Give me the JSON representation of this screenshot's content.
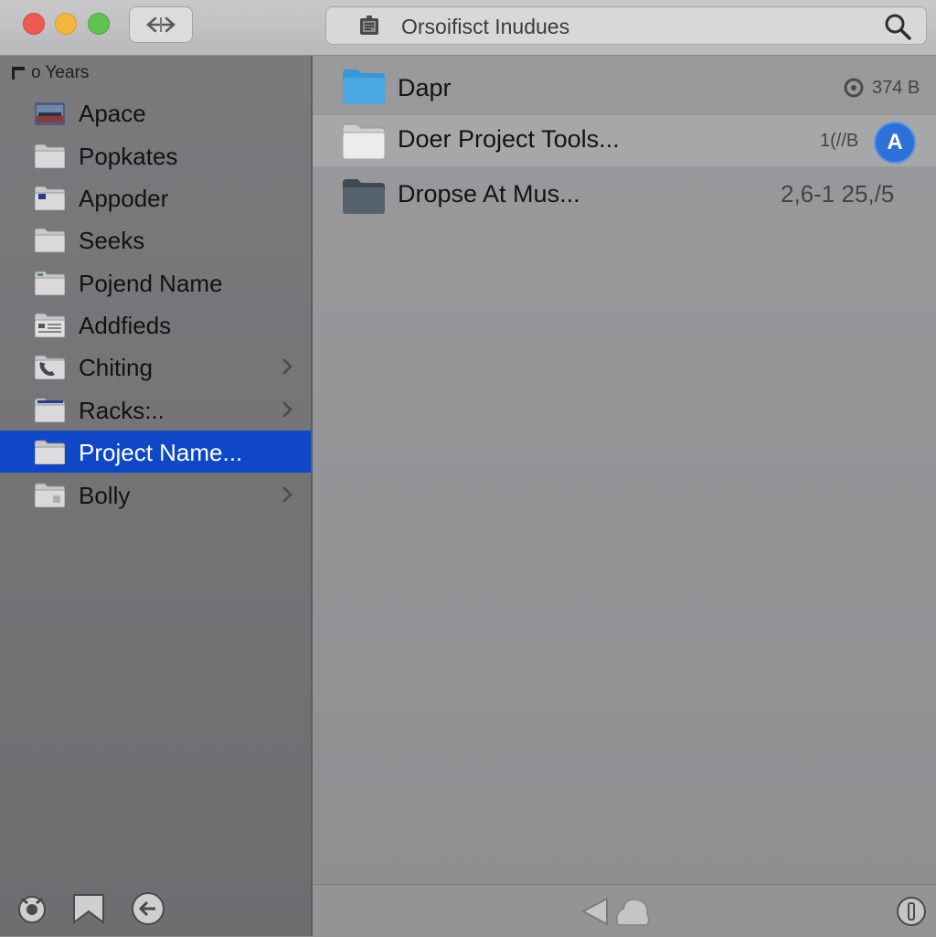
{
  "window": {
    "title": "Orsoifisct Inudues",
    "icons": {
      "close": "close-icon",
      "minimize": "minimize-icon",
      "maximize": "maximize-icon",
      "nav": "back-forward-icon",
      "search": "search-icon"
    }
  },
  "sidebar": {
    "header": "o Years",
    "items": [
      {
        "label": "Apace",
        "icon": "image-folder-icon"
      },
      {
        "label": "Popkates",
        "icon": "folder-icon"
      },
      {
        "label": "Appoder",
        "icon": "app-folder-icon"
      },
      {
        "label": "Seeks",
        "icon": "folder-icon"
      },
      {
        "label": "Pojend Name",
        "icon": "folder-icon"
      },
      {
        "label": "Addfieds",
        "icon": "document-folder-icon"
      },
      {
        "label": "Chiting",
        "icon": "phone-folder-icon"
      },
      {
        "label": "Racks:..",
        "icon": "folder-icon"
      },
      {
        "label": "Project Name...",
        "icon": "folder-icon"
      },
      {
        "label": "Bolly",
        "icon": "folder-icon"
      }
    ],
    "selected_index": 8,
    "bottom_icons": [
      "settings-icon",
      "bookmark-icon",
      "back-icon"
    ]
  },
  "main": {
    "rows": [
      {
        "name": "Dapr",
        "size": "374 B",
        "icon": "blue-folder-icon",
        "status": "sync-icon"
      },
      {
        "name": "Doer Project Tools...",
        "size": "1(//B",
        "icon": "white-folder-icon",
        "badge": "A"
      },
      {
        "name": "Dropse At Mus...",
        "size": "2,6-1 25,/5",
        "icon": "dark-folder-icon"
      }
    ]
  },
  "footer": {
    "icons": [
      "prev-icon",
      "cloud-icon",
      "info-icon"
    ]
  },
  "colors": {
    "selection": "#0f47c8",
    "avatar": "#2d71d6",
    "close": "#ee5a52",
    "minimize": "#f4b73c",
    "maximize": "#5fc34f",
    "blue_folder": "#4aa8e0"
  }
}
